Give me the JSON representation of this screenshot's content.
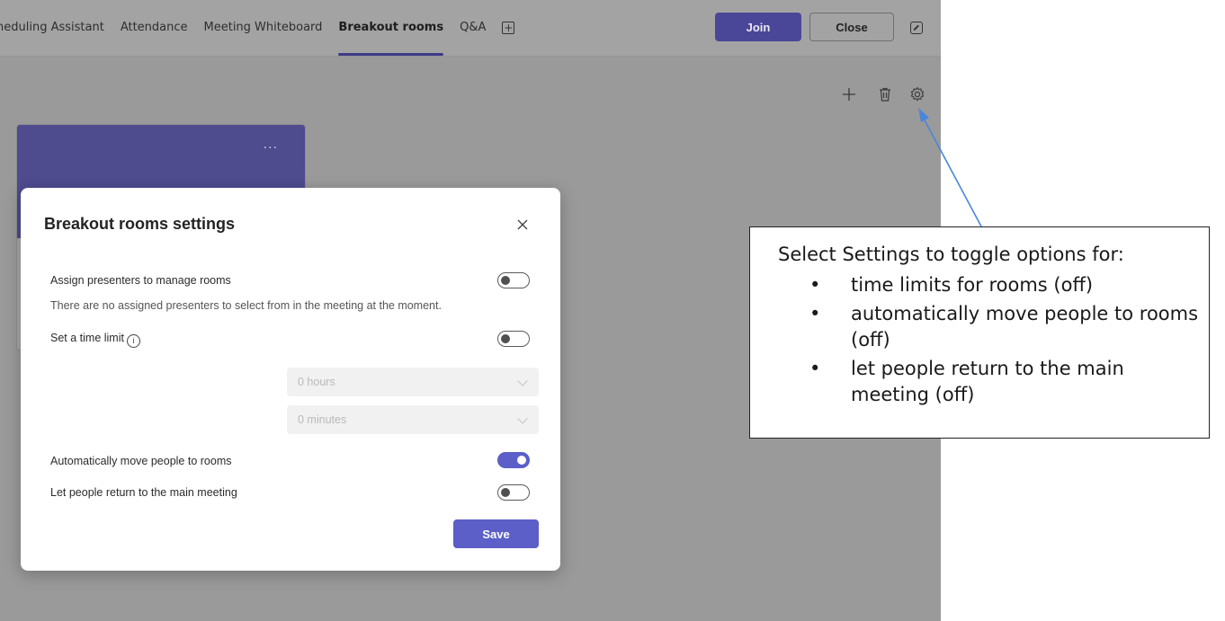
{
  "tabs": [
    {
      "label": "heduling Assistant",
      "active": false
    },
    {
      "label": "Attendance",
      "active": false
    },
    {
      "label": "Meeting Whiteboard",
      "active": false
    },
    {
      "label": "Breakout rooms",
      "active": true
    },
    {
      "label": "Q&A",
      "active": false
    }
  ],
  "header": {
    "join_label": "Join",
    "close_label": "Close"
  },
  "toolbar_icons": [
    "plus-icon",
    "trash-icon",
    "gear-icon"
  ],
  "room_card": {
    "more_label": "···"
  },
  "dialog": {
    "title": "Breakout rooms settings",
    "assign_presenters_label": "Assign presenters to manage rooms",
    "assign_presenters_note": "There are no assigned presenters to select from in the meeting at the moment.",
    "time_limit_label": "Set a time limit",
    "hours_value": "0 hours",
    "minutes_value": "0 minutes",
    "auto_move_label": "Automatically move people to rooms",
    "return_label": "Let people return to the main meeting",
    "save_label": "Save",
    "toggles": {
      "assign_presenters": false,
      "time_limit": false,
      "auto_move": true,
      "return_to_main": false
    }
  },
  "annotation": {
    "heading": "Select Settings to toggle options for:",
    "bullets": [
      "time limits for rooms (off)",
      "automatically move people to rooms (off)",
      "let people return to the main meeting (off)"
    ]
  },
  "colors": {
    "accent": "#5b5fc7",
    "tab_underline": "#3d3b86",
    "card_header": "#4e4b8f",
    "arrow": "#4a86d9"
  }
}
